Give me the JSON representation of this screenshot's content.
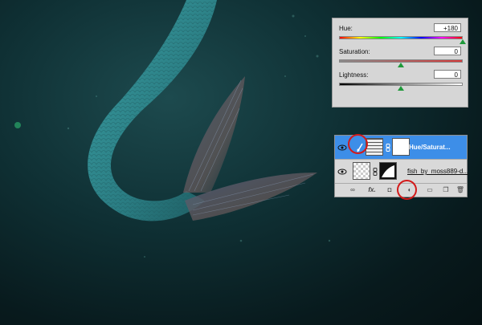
{
  "hue_saturation": {
    "hue": {
      "label": "Hue:",
      "value": "+180",
      "level": 1.0
    },
    "saturation": {
      "label": "Saturation:",
      "value": "0",
      "level": 0.5
    },
    "lightness": {
      "label": "Lightness:",
      "value": "0",
      "level": 0.5
    }
  },
  "layers": [
    {
      "name": "Hue/Saturat...",
      "selected": true,
      "type": "adjustment"
    },
    {
      "name": "fish_by_moss889-d...",
      "selected": false,
      "type": "image"
    }
  ],
  "layers_toolbar": {
    "icons": [
      "link-icon",
      "fx-icon",
      "mask-icon",
      "adjustment-layer-icon",
      "group-folder-icon",
      "new-layer-icon",
      "trash-icon"
    ],
    "fx_label": "fx."
  },
  "colors": {
    "selection": "#3d8ee8",
    "annotation": "#d31a1a",
    "tail": "#2f8a8e"
  }
}
